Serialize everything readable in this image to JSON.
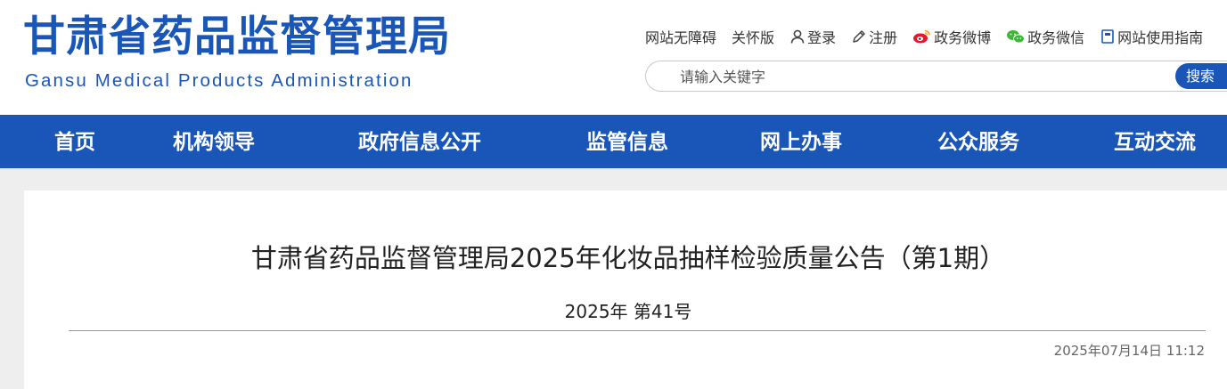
{
  "site": {
    "name_cn": "甘肃省药品监督管理局",
    "name_en": "Gansu Medical Products Administration"
  },
  "toplinks": {
    "accessibility": "网站无障碍",
    "care_mode": "关怀版",
    "login": "登录",
    "register": "注册",
    "weibo": "政务微博",
    "wechat": "政务微信",
    "guide": "网站使用指南"
  },
  "search": {
    "placeholder": "请输入关键字",
    "button": "搜索"
  },
  "nav": [
    "首页",
    "机构领导",
    "政府信息公开",
    "监管信息",
    "网上办事",
    "公众服务",
    "互动交流"
  ],
  "article": {
    "title": "甘肃省药品监督管理局2025年化妆品抽样检验质量公告（第1期）",
    "doc_number": "2025年 第41号",
    "date": "2025年07月14日 11:12"
  },
  "colors": {
    "brand": "#1a56b8",
    "weibo_red": "#e6162d",
    "wechat_green": "#3fb53a"
  }
}
